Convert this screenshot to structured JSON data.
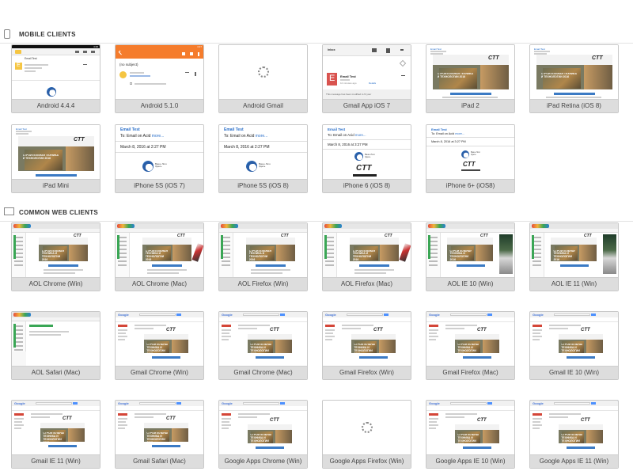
{
  "sections": {
    "mobile": {
      "label": "MOBILE CLIENTS",
      "icon": "phone-icon"
    },
    "web": {
      "label": "COMMON WEB CLIENTS",
      "icon": "monitor-icon"
    }
  },
  "mobile_clients": [
    {
      "label": "Android 4.4.4",
      "kind": "android444"
    },
    {
      "label": "Android 5.1.0",
      "kind": "android510"
    },
    {
      "label": "Android Gmail",
      "kind": "loading"
    },
    {
      "label": "Gmail App iOS 7",
      "kind": "gmailapp"
    },
    {
      "label": "iPad 2",
      "kind": "ipad"
    },
    {
      "label": "iPad Retina (iOS 8)",
      "kind": "ipad"
    },
    {
      "label": "iPad Mini",
      "kind": "ipadmini"
    },
    {
      "label": "iPhone 5S (iOS 7)",
      "kind": "iphone"
    },
    {
      "label": "iPhone 5S (iOS 8)",
      "kind": "iphone"
    },
    {
      "label": "iPhone 6 (iOS 8)",
      "kind": "iphone6"
    },
    {
      "label": "iPhone 6+ (iOS8)",
      "kind": "iphone6plus"
    }
  ],
  "web_clients": [
    {
      "label": "AOL Chrome (Win)",
      "kind": "aol"
    },
    {
      "label": "AOL Chrome (Mac)",
      "kind": "aolmac"
    },
    {
      "label": "AOL Firefox (Win)",
      "kind": "aol"
    },
    {
      "label": "AOL Firefox (Mac)",
      "kind": "aolmac"
    },
    {
      "label": "AOL IE 10 (Win)",
      "kind": "aolie"
    },
    {
      "label": "AOL IE 11 (Win)",
      "kind": "aolie"
    },
    {
      "label": "AOL Safari (Mac)",
      "kind": "aolsafari"
    },
    {
      "label": "Gmail Chrome (Win)",
      "kind": "gmail"
    },
    {
      "label": "Gmail Chrome (Mac)",
      "kind": "gmail"
    },
    {
      "label": "Gmail Firefox (Win)",
      "kind": "gmail"
    },
    {
      "label": "Gmail Firefox (Mac)",
      "kind": "gmail"
    },
    {
      "label": "Gmail IE 10 (Win)",
      "kind": "gmail"
    },
    {
      "label": "Gmail IE 11 (Win)",
      "kind": "gmail"
    },
    {
      "label": "Gmail Safari (Mac)",
      "kind": "gmail"
    },
    {
      "label": "Google Apps Chrome (Win)",
      "kind": "gapps"
    },
    {
      "label": "Google Apps Firefox (Win)",
      "kind": "loading"
    },
    {
      "label": "Google Apps IE 10 (Win)",
      "kind": "gapps"
    },
    {
      "label": "Google Apps IE 11 (Win)",
      "kind": "gapps11"
    }
  ],
  "email": {
    "subject": "Email Test",
    "to_line": "To: Email on Acid",
    "more": "more...",
    "date": "March 8, 2016 at 2:27 PM",
    "date_short": "March 8, 2016 at 3:27 PM",
    "no_subject": "(no subject)",
    "time_ago": "10 minutes ago",
    "details": "Details",
    "modified_note": "This message has been modified to fit your",
    "inbox": "Inbox",
    "android_time": "4:26",
    "android510_time": "4:27",
    "sender_initial": "E",
    "logo_caption": "Ваше Лого Здесь",
    "ctt": "CTT",
    "banner_text": "СТРОИТЕЛЬНАЯ ТЕХНИКА И ТЕХНОЛОГИИ 2016"
  },
  "colors": {
    "android510_orange": "#f57c2c",
    "android_avatar": "#f5c542",
    "gmail_red": "#d44638",
    "gmail_e": "#d9534f",
    "link_blue": "#2a6fc9",
    "caption_bg": "#dddddd"
  }
}
